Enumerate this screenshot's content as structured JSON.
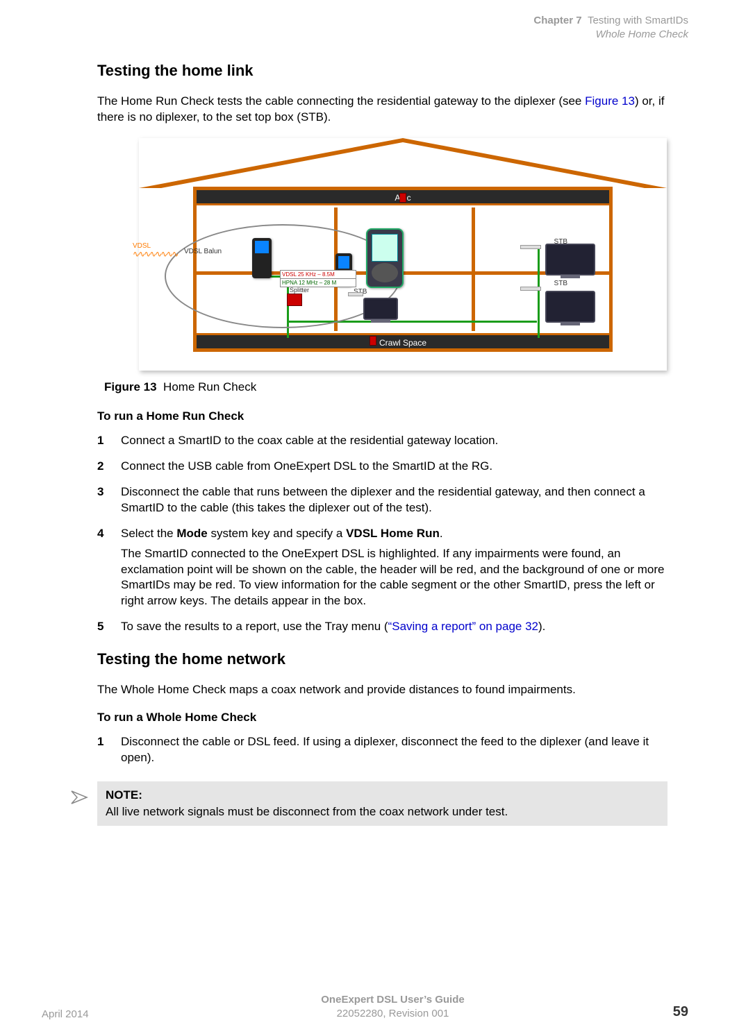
{
  "header": {
    "chapter": "Chapter 7",
    "chapter_title": "Testing with SmartIDs",
    "section": "Whole Home Check"
  },
  "section1": {
    "heading": "Testing the home link",
    "intro_pre": "The Home Run Check tests the cable connecting the residential gateway to the diplexer (see ",
    "intro_link": "Figure 13",
    "intro_post": ") or, if there is no diplexer, to the set top box (STB).",
    "figure_label": "Figure 13",
    "figure_caption": "Home Run Check",
    "diagram": {
      "attic": "Attic",
      "crawl": "Crawl Space",
      "vdsl": "VDSL",
      "balun": "VDSL\nBalun",
      "freq_vdsl": "VDSL 25 KHz – 8.5M",
      "freq_hpna": "HPNA 12 MHz – 28 M",
      "stb": "STB",
      "splitter": "Splitter"
    },
    "procedure_heading": "To run a Home Run Check",
    "steps": [
      {
        "n": "1",
        "text": "Connect a SmartID to the coax cable at the residential gateway location."
      },
      {
        "n": "2",
        "text": "Connect the USB cable from OneExpert DSL to the SmartID at the RG."
      },
      {
        "n": "3",
        "text": "Disconnect the cable that runs between the diplexer and the residential gateway, and then connect a SmartID to the cable (this takes the diplexer out of the test)."
      },
      {
        "n": "4",
        "pre": "Select the ",
        "b1": "Mode",
        "mid": " system key and specify a ",
        "b2": "VDSL Home Run",
        "post": ".",
        "followup": "The SmartID connected to the OneExpert DSL is highlighted. If any impairments were found, an exclamation point will be shown on the cable, the header will be red, and the background of one or more SmartIDs may be red. To view information for the cable segment or the other SmartID, press the left or right arrow keys. The details appear in the box."
      },
      {
        "n": "5",
        "pre": "To save the results to a report, use the Tray menu (",
        "link": "“Saving a report” on page 32",
        "post": ")."
      }
    ]
  },
  "section2": {
    "heading": "Testing the home network",
    "intro": "The Whole Home Check maps a coax network and provide distances to found impairments.",
    "procedure_heading": "To run a Whole Home Check",
    "steps": [
      {
        "n": "1",
        "text": "Disconnect the cable or DSL feed. If using a diplexer, disconnect the feed to the diplexer (and leave it open)."
      }
    ],
    "note_title": "NOTE:",
    "note_body": "All live network signals must be disconnect from the coax network under test."
  },
  "footer": {
    "date": "April 2014",
    "guide": "OneExpert DSL User’s Guide",
    "docnum": "22052280, Revision 001",
    "page": "59"
  }
}
